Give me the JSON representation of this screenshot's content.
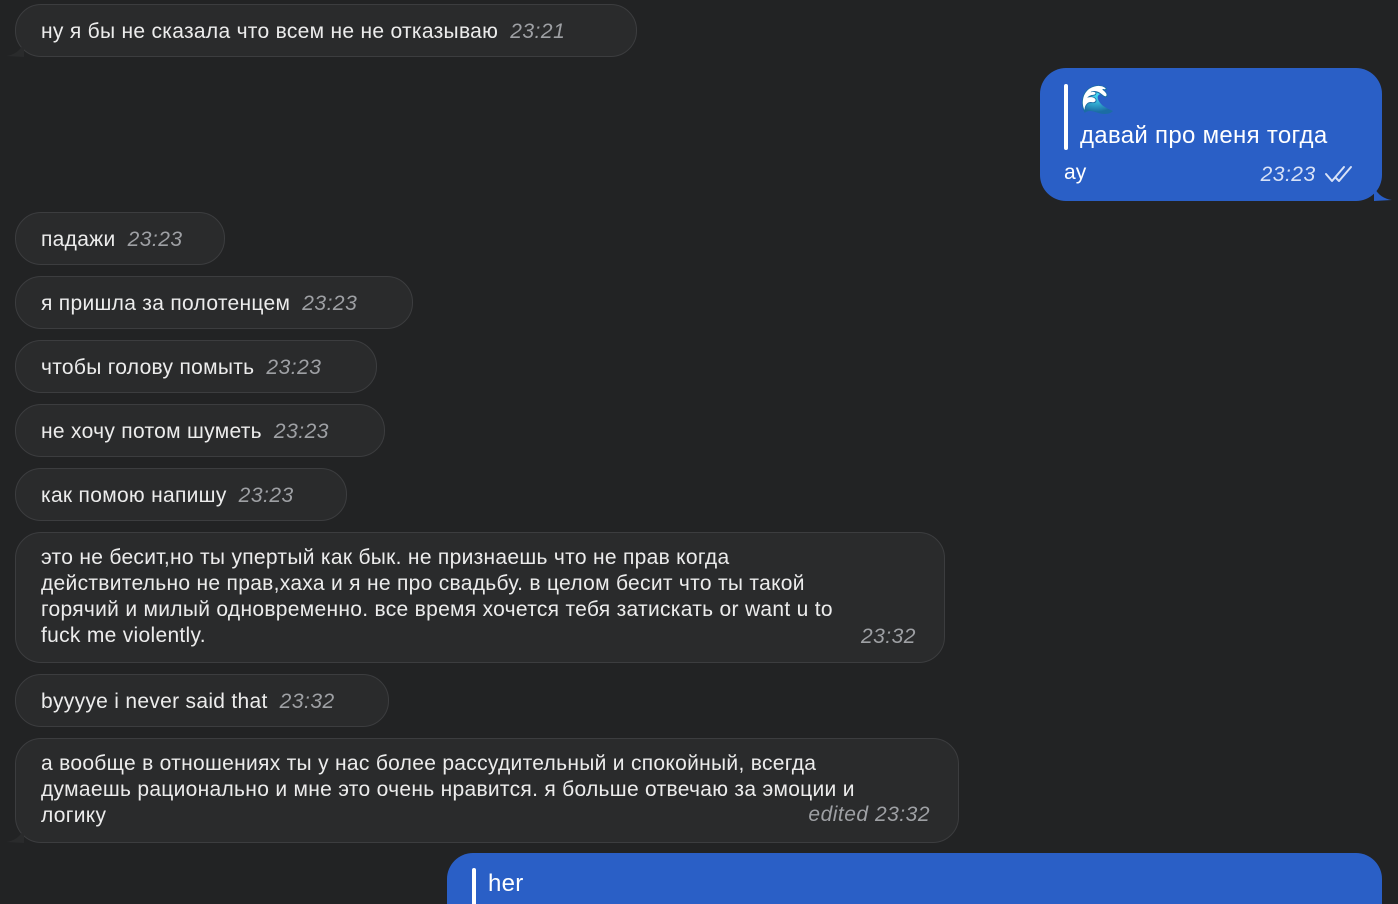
{
  "messages": {
    "m1": {
      "text": "ну я бы не сказала что всем не не отказываю",
      "time": "23:21"
    },
    "out1": {
      "emoji": "🌊",
      "quote": "давай про меня тогда",
      "text": "ау",
      "time": "23:23"
    },
    "m2": {
      "text": "падажи",
      "time": "23:23"
    },
    "m3": {
      "text": "я пришла за полотенцем",
      "time": "23:23"
    },
    "m4": {
      "text": "чтобы голову помыть",
      "time": "23:23"
    },
    "m5": {
      "text": "не хочу потом шуметь",
      "time": "23:23"
    },
    "m6": {
      "text": "как помою напишу",
      "time": "23:23"
    },
    "m7": {
      "lines": [
        "это не бесит,но ты упертый как бык. не признаешь что не прав когда",
        "действительно не прав,хаха и я не про свадьбу. в целом бесит что ты такой",
        "горячий и милый одновременно. все время хочется тебя затискать or want u to",
        "fuck me violently."
      ],
      "time": "23:32"
    },
    "m8": {
      "text": "byyyye i never said that",
      "time": "23:32"
    },
    "m9": {
      "lines": [
        "а вообще в отношениях ты у нас более рассудительный и спокойный, всегда",
        "думаешь рационально и мне это очень нравится. я больше отвечаю за эмоции и",
        "логику"
      ],
      "time": "edited 23:32"
    },
    "out2": {
      "quote": "her"
    }
  },
  "colors": {
    "background": "#222324",
    "incoming_bubble": "#2a2b2c",
    "outgoing_bubble": "#2a5fc6",
    "timestamp": "#9ea0a4"
  }
}
